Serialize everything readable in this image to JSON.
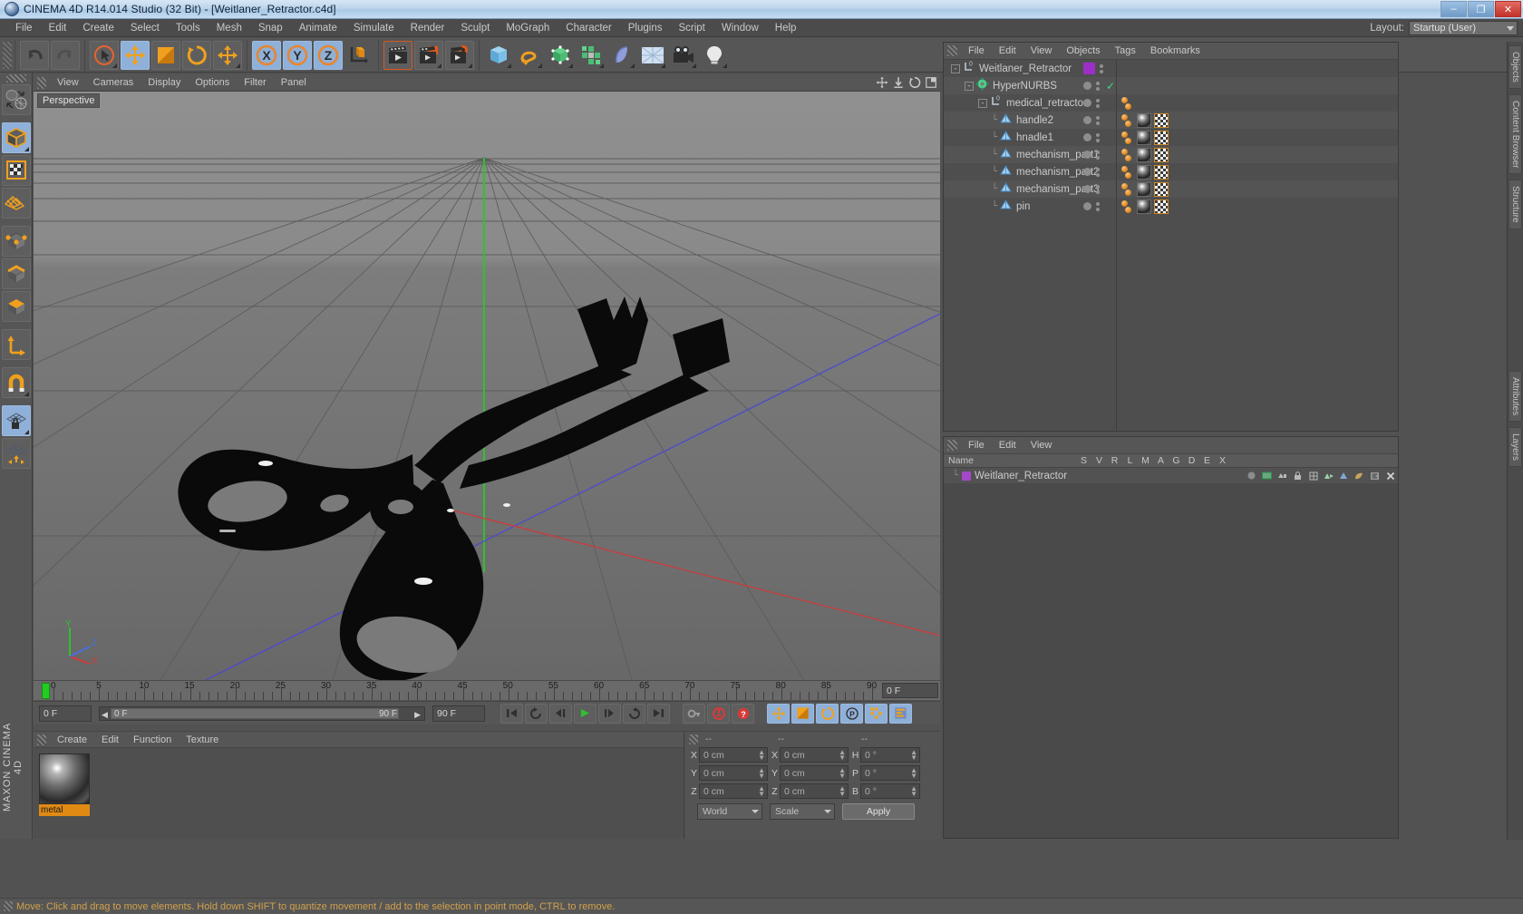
{
  "window": {
    "title": "CINEMA 4D R14.014 Studio (32 Bit) - [Weitlaner_Retractor.c4d]",
    "minimize_label": "–",
    "maximize_label": "❐",
    "close_label": "✕"
  },
  "menubar": {
    "items": [
      "File",
      "Edit",
      "Create",
      "Select",
      "Tools",
      "Mesh",
      "Snap",
      "Animate",
      "Simulate",
      "Render",
      "Sculpt",
      "MoGraph",
      "Character",
      "Plugins",
      "Script",
      "Window",
      "Help"
    ],
    "layout_label": "Layout:",
    "layout_value": "Startup (User)"
  },
  "toolbar": {
    "buttons": [
      {
        "name": "undo-button",
        "icon": "undo-arrow",
        "selected": false
      },
      {
        "name": "redo-button",
        "icon": "redo-arrow",
        "selected": false
      },
      {
        "name": "live-selection-button",
        "icon": "cursor-circle",
        "selected": false
      },
      {
        "name": "move-tool-button",
        "icon": "move-cross",
        "selected": true
      },
      {
        "name": "scale-tool-button",
        "icon": "scale-square",
        "selected": false
      },
      {
        "name": "rotate-tool-button",
        "icon": "rotate-circle",
        "selected": false
      },
      {
        "name": "move-axis-button",
        "icon": "move-cross",
        "selected": false
      },
      {
        "name": "x-axis-lock-button",
        "icon": "axis-x",
        "selected": true
      },
      {
        "name": "y-axis-lock-button",
        "icon": "axis-y",
        "selected": true
      },
      {
        "name": "z-axis-lock-button",
        "icon": "axis-z",
        "selected": true
      },
      {
        "name": "world-object-coord-button",
        "icon": "axis-cube",
        "selected": false
      },
      {
        "name": "render-view-button",
        "icon": "clapper",
        "selected": false
      },
      {
        "name": "render-region-button",
        "icon": "clapper-region",
        "selected": false
      },
      {
        "name": "render-settings-button",
        "icon": "clapper-gear",
        "selected": false
      },
      {
        "name": "add-cube-button",
        "icon": "cube-blue",
        "selected": false
      },
      {
        "name": "add-spline-button",
        "icon": "spline-orange",
        "selected": false
      },
      {
        "name": "nurbs-button",
        "icon": "hypernurbs-green",
        "selected": false
      },
      {
        "name": "array-button",
        "icon": "array-green",
        "selected": false
      },
      {
        "name": "deformer-button",
        "icon": "bend-deformer",
        "selected": false
      },
      {
        "name": "environment-button",
        "icon": "floor-environment",
        "selected": false
      },
      {
        "name": "camera-button",
        "icon": "camera",
        "selected": false
      },
      {
        "name": "light-button",
        "icon": "lightbulb",
        "selected": false
      }
    ]
  },
  "lefttools": {
    "buttons": [
      {
        "name": "undo-view-button",
        "icon": "globe-arrows",
        "selected": false
      },
      {
        "name": "model-mode-button",
        "icon": "cube-solid",
        "selected": true
      },
      {
        "name": "texture-mode-button",
        "icon": "checker-square",
        "selected": false
      },
      {
        "name": "uv-polygon-mode-button",
        "icon": "uv-mesh",
        "selected": false
      },
      {
        "name": "points-mode-button",
        "icon": "cube-points",
        "selected": false
      },
      {
        "name": "edges-mode-button",
        "icon": "cube-edges",
        "selected": false
      },
      {
        "name": "polygons-mode-button",
        "icon": "cube-polys",
        "selected": false
      },
      {
        "name": "axis-mode-button",
        "icon": "axis-tool",
        "selected": false
      },
      {
        "name": "enable-snap-button",
        "icon": "magnet",
        "selected": false
      },
      {
        "name": "workplane-lock-button",
        "icon": "grid-lock",
        "selected": true
      },
      {
        "name": "workplane-mode-button",
        "icon": "grid-move",
        "selected": false
      }
    ],
    "brand_label": "MAXON CINEMA 4D"
  },
  "viewport": {
    "menu_items": [
      "View",
      "Cameras",
      "Display",
      "Options",
      "Filter",
      "Panel"
    ],
    "camera_label": "Perspective",
    "axis_labels": {
      "x": "X",
      "y": "Y",
      "z": "Z"
    }
  },
  "timeline": {
    "ticks": [
      0,
      5,
      10,
      15,
      20,
      25,
      30,
      35,
      40,
      45,
      50,
      55,
      60,
      65,
      70,
      75,
      80,
      85,
      90
    ],
    "current_frame_field": "0 F",
    "start_frame": "0 F",
    "range_left": "0 F",
    "range_right": "90 F",
    "end_frame": "90 F",
    "transport_buttons": [
      {
        "name": "go-to-start-button",
        "icon": "skip-start"
      },
      {
        "name": "play-reverse-button",
        "icon": "loop-left"
      },
      {
        "name": "step-back-button",
        "icon": "prev-frame"
      },
      {
        "name": "play-button",
        "icon": "play"
      },
      {
        "name": "step-forward-button",
        "icon": "next-frame"
      },
      {
        "name": "play-forward-loop-button",
        "icon": "loop-right"
      },
      {
        "name": "go-to-end-button",
        "icon": "skip-end"
      }
    ],
    "record_buttons": [
      {
        "name": "record-key-button",
        "icon": "key"
      },
      {
        "name": "autokey-button",
        "icon": "autokey-circle"
      },
      {
        "name": "keyframe-selection-button",
        "icon": "question-circle"
      }
    ],
    "key_filter_buttons": [
      {
        "name": "position-key-button",
        "icon": "move-cross",
        "selected": true
      },
      {
        "name": "scale-key-button",
        "icon": "scale-square",
        "selected": true
      },
      {
        "name": "rotation-key-button",
        "icon": "rotate-circle",
        "selected": true
      },
      {
        "name": "parameter-key-button",
        "icon": "param-p",
        "selected": true
      },
      {
        "name": "pla-key-button",
        "icon": "point-grid",
        "selected": true
      },
      {
        "name": "timeline-toggle-button",
        "icon": "timeline-bars",
        "selected": true
      }
    ]
  },
  "material_manager": {
    "menu_items": [
      "Create",
      "Edit",
      "Function",
      "Texture"
    ],
    "materials": [
      {
        "name": "metal"
      }
    ]
  },
  "coordinates": {
    "header_cols": [
      "--",
      "--",
      "--"
    ],
    "rows": [
      {
        "label_pos": "X",
        "value_pos": "0 cm",
        "label_size": "X",
        "value_size": "0 cm",
        "label_rot": "H",
        "value_rot": "0 °"
      },
      {
        "label_pos": "Y",
        "value_pos": "0 cm",
        "label_size": "Y",
        "value_size": "0 cm",
        "label_rot": "P",
        "value_rot": "0 °"
      },
      {
        "label_pos": "Z",
        "value_pos": "0 cm",
        "label_size": "Z",
        "value_size": "0 cm",
        "label_rot": "B",
        "value_rot": "0 °"
      }
    ],
    "space_dropdown": "World",
    "mode_dropdown": "Scale",
    "apply_label": "Apply"
  },
  "object_manager": {
    "menu_items": [
      "File",
      "Edit",
      "View",
      "Objects",
      "Tags",
      "Bookmarks"
    ],
    "rows": [
      {
        "name": "Weitlaner_Retractor",
        "depth": 0,
        "icon": "null-object",
        "expander": "minus",
        "chip_color": "#9b2fc8",
        "dot": false,
        "check": false,
        "tags": []
      },
      {
        "name": "HyperNURBS",
        "depth": 1,
        "icon": "hypernurbs",
        "expander": "minus",
        "chip_color": "",
        "dot": true,
        "check": true,
        "tags": []
      },
      {
        "name": "medical_retractor",
        "depth": 2,
        "icon": "null-object",
        "expander": "minus",
        "chip_color": "",
        "dot": true,
        "check": false,
        "tags": [
          "ball"
        ]
      },
      {
        "name": "handle2",
        "depth": 3,
        "icon": "polygon-object",
        "expander": "none",
        "chip_color": "",
        "dot": true,
        "check": false,
        "tags": [
          "ball",
          "material",
          "texture"
        ]
      },
      {
        "name": "hnadle1",
        "depth": 3,
        "icon": "polygon-object",
        "expander": "none",
        "chip_color": "",
        "dot": true,
        "check": false,
        "tags": [
          "ball",
          "material",
          "texture"
        ]
      },
      {
        "name": "mechanism_part1",
        "depth": 3,
        "icon": "polygon-object",
        "expander": "none",
        "chip_color": "",
        "dot": true,
        "check": false,
        "tags": [
          "ball",
          "material",
          "texture"
        ]
      },
      {
        "name": "mechanism_part2",
        "depth": 3,
        "icon": "polygon-object",
        "expander": "none",
        "chip_color": "",
        "dot": true,
        "check": false,
        "tags": [
          "ball",
          "material",
          "texture"
        ]
      },
      {
        "name": "mechanism_part3",
        "depth": 3,
        "icon": "polygon-object",
        "expander": "none",
        "chip_color": "",
        "dot": true,
        "check": false,
        "tags": [
          "ball",
          "material",
          "texture"
        ]
      },
      {
        "name": "pin",
        "depth": 3,
        "icon": "polygon-object",
        "expander": "none",
        "chip_color": "",
        "dot": true,
        "check": false,
        "tags": [
          "ball",
          "material",
          "texture"
        ]
      }
    ]
  },
  "layer_manager": {
    "menu_items": [
      "File",
      "Edit",
      "View"
    ],
    "columns": [
      "Name",
      "S",
      "V",
      "R",
      "L",
      "M",
      "A",
      "G",
      "D",
      "E",
      "X"
    ],
    "rows": [
      {
        "name": "Weitlaner_Retractor",
        "color": "#a248c9"
      }
    ]
  },
  "right_dock": {
    "tabs": [
      "Objects",
      "Content Browser",
      "Structure",
      "Attributes",
      "Layers"
    ]
  },
  "statusbar": {
    "message": "Move: Click and drag to move elements. Hold down SHIFT to quantize movement / add to the selection in point mode, CTRL to remove."
  },
  "colors": {
    "accent_orange": "#e08a14",
    "selection_blue": "#8fb0d8",
    "panel_bg": "#565656",
    "viewport_top": "#8f8f8f"
  }
}
